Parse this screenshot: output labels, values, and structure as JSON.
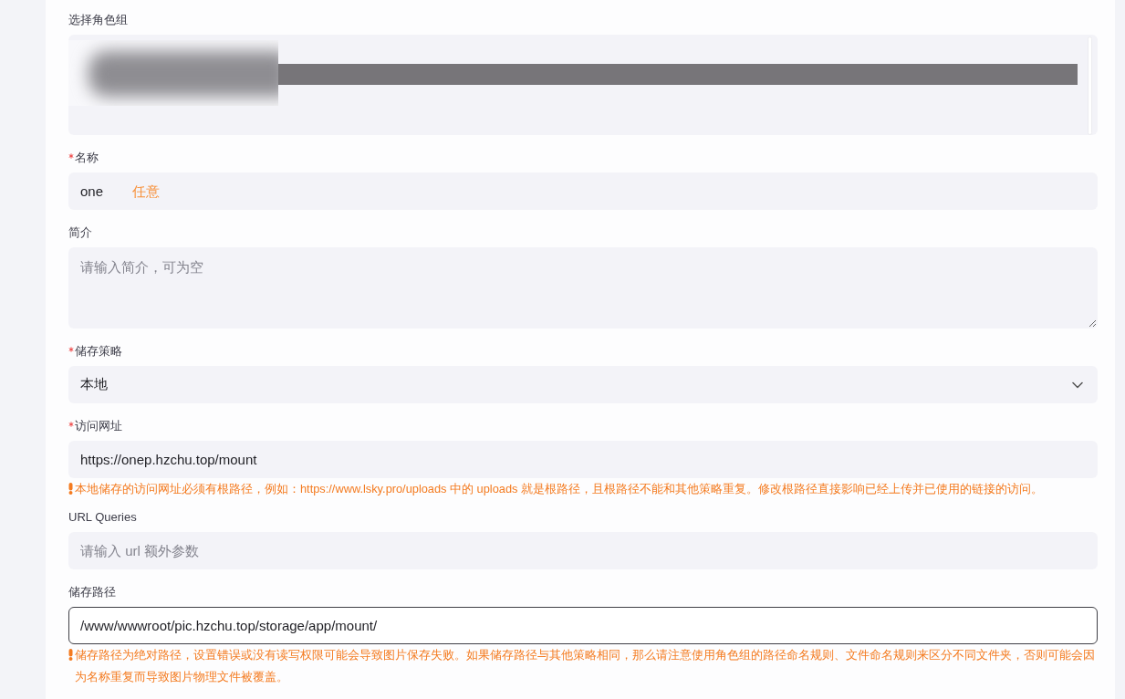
{
  "role_group": {
    "label": "选择角色组"
  },
  "fields": [
    {
      "kind": "input",
      "label": "名称",
      "required": true,
      "focused": false,
      "value": "one",
      "annotation": "任意"
    },
    {
      "kind": "textarea",
      "label": "简介",
      "required": false,
      "focused": false,
      "placeholder": "请输入简介，可为空"
    },
    {
      "kind": "select",
      "label": "储存策略",
      "required": true,
      "focused": false,
      "value": "本地"
    },
    {
      "kind": "input",
      "label": "访问网址",
      "required": true,
      "focused": false,
      "value": "https://onep.hzchu.top/mount",
      "hint": "本地储存的访问网址必须有根路径，例如：https://www.lsky.pro/uploads 中的 uploads 就是根路径，且根路径不能和其他策略重复。修改根路径直接影响已经上传并已使用的链接的访问。"
    },
    {
      "kind": "input",
      "label": "URL Queries",
      "required": false,
      "focused": false,
      "placeholder": "请输入 url 额外参数"
    },
    {
      "kind": "input",
      "label": "储存路径",
      "required": false,
      "focused": true,
      "value": "/www/wwwroot/pic.hzchu.top/storage/app/mount/",
      "hint": "储存路径为绝对路径，设置错误或没有读写权限可能会导致图片保存失败。如果储存路径与其他策略相同，那么请注意使用角色组的路径命名规则、文件命名规则来区分不同文件夹，否则可能会因为名称重复而导致图片物理文件被覆盖。"
    }
  ]
}
